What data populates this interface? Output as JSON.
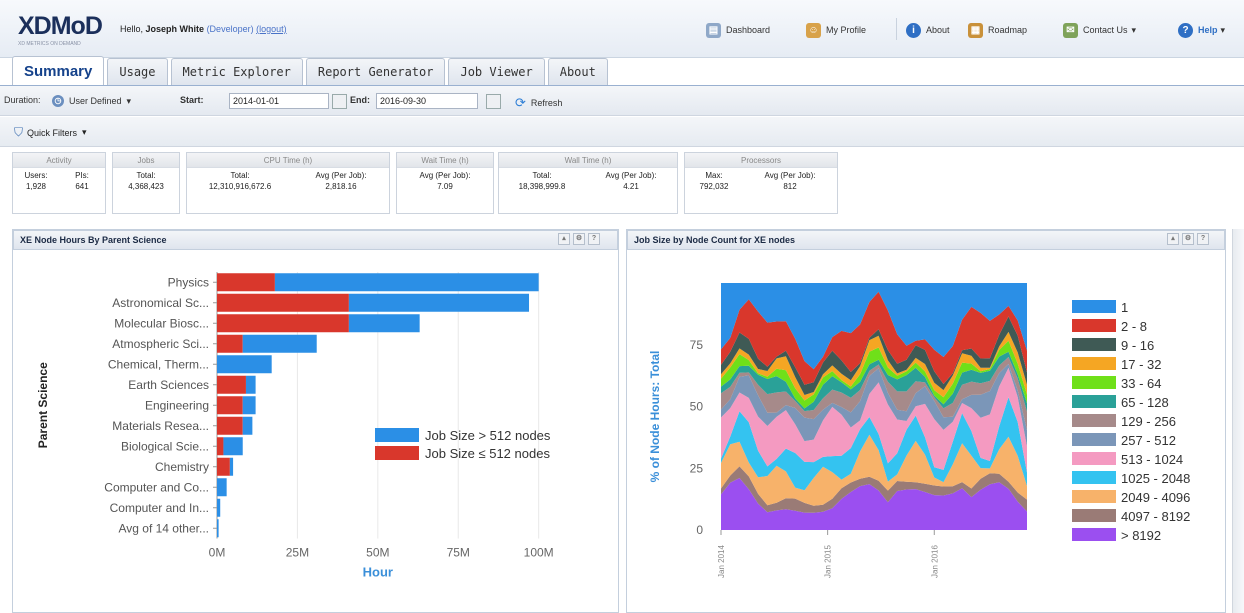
{
  "header": {
    "logo": "XDMoD",
    "logo_sub": "XD METRICS ON DEMAND",
    "greeting_prefix": "Hello,",
    "user_name": "Joseph White",
    "role": "(Developer)",
    "logout": "(logout)",
    "links": [
      {
        "label": "Dashboard",
        "icon": "dashboard-icon"
      },
      {
        "label": "My Profile",
        "icon": "profile-icon"
      },
      {
        "label": "About",
        "icon": "info-icon"
      },
      {
        "label": "Roadmap",
        "icon": "roadmap-icon"
      },
      {
        "label": "Contact Us",
        "icon": "contact-icon"
      },
      {
        "label": "Help",
        "icon": "help-icon"
      }
    ]
  },
  "tabs": [
    "Summary",
    "Usage",
    "Metric Explorer",
    "Report Generator",
    "Job Viewer",
    "About"
  ],
  "toolbar": {
    "duration_label": "Duration:",
    "duration_value": "User Defined",
    "start_label": "Start:",
    "start_value": "2014-01-01",
    "end_label": "End:",
    "end_value": "2016-09-30",
    "refresh": "Refresh",
    "quick_filters": "Quick Filters"
  },
  "summary": {
    "activity": {
      "title": "Activity",
      "users_label": "Users:",
      "users": "1,928",
      "pis_label": "PIs:",
      "pis": "641"
    },
    "jobs": {
      "title": "Jobs",
      "total_label": "Total:",
      "total": "4,368,423"
    },
    "cpu": {
      "title": "CPU Time (h)",
      "total_label": "Total:",
      "total": "12,310,916,672.6",
      "avg_label": "Avg (Per Job):",
      "avg": "2,818.16"
    },
    "wait": {
      "title": "Wait Time (h)",
      "avg_label": "Avg (Per Job):",
      "avg": "7.09"
    },
    "wall": {
      "title": "Wall Time (h)",
      "total_label": "Total:",
      "total": "18,398,999.8",
      "avg_label": "Avg (Per Job):",
      "avg": "4.21"
    },
    "processors": {
      "title": "Processors",
      "max_label": "Max:",
      "max": "792,032",
      "avg_label": "Avg (Per Job):",
      "avg": "812"
    }
  },
  "panels": {
    "left_title": "XE Node Hours By Parent Science",
    "right_title": "Job Size by Node Count for XE nodes"
  },
  "chart_data": [
    {
      "type": "bar",
      "orientation": "horizontal",
      "stacked": true,
      "categories": [
        "Physics",
        "Astronomical Sc...",
        "Molecular Biosc...",
        "Atmospheric Sci...",
        "Chemical, Therm...",
        "Earth Sciences",
        "Engineering",
        "Materials Resea...",
        "Biological Scie...",
        "Chemistry",
        "Computer and Co...",
        "Computer and In...",
        "Avg of 14 other..."
      ],
      "series": [
        {
          "name": "Job Size ≤ 512 nodes",
          "color": "#d9372c",
          "values": [
            18,
            41,
            41,
            8,
            0,
            9,
            8,
            8,
            2,
            4,
            0,
            0,
            0
          ]
        },
        {
          "name": "Job Size > 512 nodes",
          "color": "#2b8fe6",
          "values": [
            82,
            56,
            22,
            23,
            17,
            3,
            4,
            3,
            6,
            1,
            3,
            1,
            0.5
          ]
        }
      ],
      "xlabel": "Hour",
      "ylabel": "Parent Science",
      "xticks": [
        "0M",
        "25M",
        "50M",
        "75M",
        "100M"
      ],
      "xlim": [
        0,
        120
      ],
      "legend": "right"
    },
    {
      "type": "area",
      "stacked": true,
      "ylabel": "% of Node Hours: Total",
      "yticks": [
        "0",
        "25",
        "50",
        "75"
      ],
      "ylim": [
        0,
        100
      ],
      "xticks": [
        "Jan 2014",
        "Jan 2015",
        "Jan 2016"
      ],
      "legend": "right",
      "series": [
        {
          "name": "1",
          "color": "#2b8fe6"
        },
        {
          "name": "2 - 8",
          "color": "#d9372c"
        },
        {
          "name": "9 - 16",
          "color": "#3f5a55"
        },
        {
          "name": "17 - 32",
          "color": "#f5a623"
        },
        {
          "name": "33 - 64",
          "color": "#6fe019"
        },
        {
          "name": "65 - 128",
          "color": "#2aa198"
        },
        {
          "name": "129 - 256",
          "color": "#a68a8a"
        },
        {
          "name": "257 - 512",
          "color": "#7b96b8"
        },
        {
          "name": "513 - 1024",
          "color": "#f49ac1"
        },
        {
          "name": "1025 - 2048",
          "color": "#34c3f0"
        },
        {
          "name": "2049 - 4096",
          "color": "#f7b26a"
        },
        {
          "name": "4097 - 8192",
          "color": "#9a7b76"
        },
        {
          "name": "> 8192",
          "color": "#9b4ff0"
        }
      ]
    }
  ]
}
